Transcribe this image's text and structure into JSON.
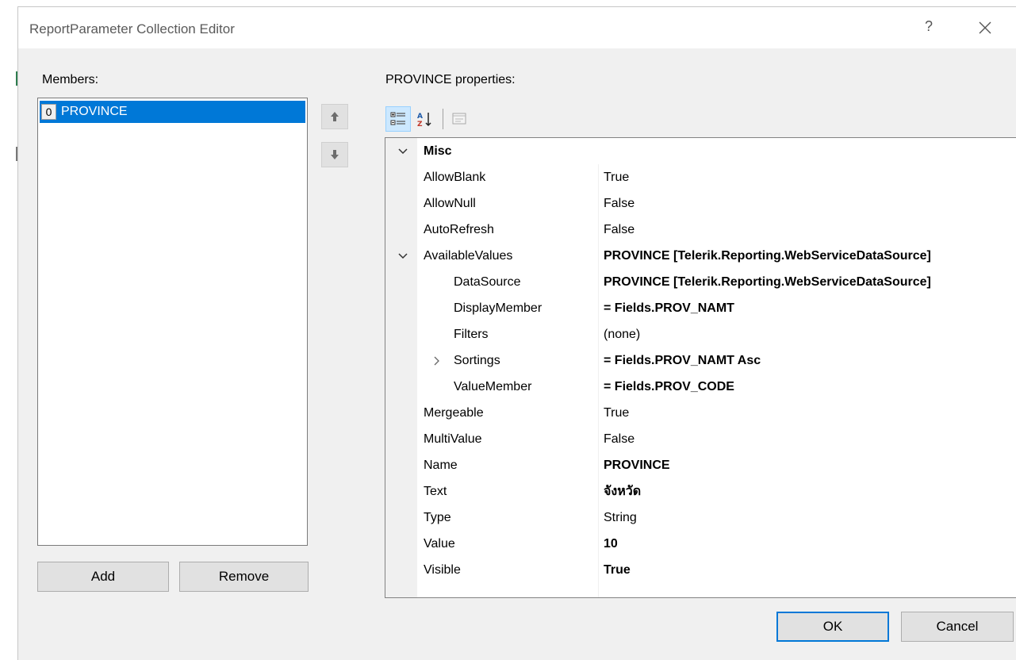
{
  "dialog": {
    "title": "ReportParameter Collection Editor",
    "help_glyph": "?",
    "accent_color": "#0078d7"
  },
  "members": {
    "label": "Members:",
    "items": [
      {
        "index": "0",
        "name": "PROVINCE",
        "selected": true
      }
    ],
    "add_label": "Add",
    "remove_label": "Remove"
  },
  "properties": {
    "label": "PROVINCE properties:",
    "toolbar": [
      "categorized-icon",
      "alphabetical-icon",
      "property-pages-icon"
    ],
    "category": "Misc",
    "rows": [
      {
        "name": "AllowBlank",
        "value": "True",
        "bold": false
      },
      {
        "name": "AllowNull",
        "value": "False",
        "bold": false
      },
      {
        "name": "AutoRefresh",
        "value": "False",
        "bold": false
      },
      {
        "name": "AvailableValues",
        "value": "PROVINCE [Telerik.Reporting.WebServiceDataSource]",
        "bold": true
      },
      {
        "name": "DataSource",
        "value": "PROVINCE [Telerik.Reporting.WebServiceDataSource]",
        "bold": true
      },
      {
        "name": "DisplayMember",
        "value": "= Fields.PROV_NAMT",
        "bold": true
      },
      {
        "name": "Filters",
        "value": "(none)",
        "bold": false
      },
      {
        "name": "Sortings",
        "value": "= Fields.PROV_NAMT Asc",
        "bold": true
      },
      {
        "name": "ValueMember",
        "value": "= Fields.PROV_CODE",
        "bold": true
      },
      {
        "name": "Mergeable",
        "value": "True",
        "bold": false
      },
      {
        "name": "MultiValue",
        "value": "False",
        "bold": false
      },
      {
        "name": "Name",
        "value": "PROVINCE",
        "bold": true
      },
      {
        "name": "Text",
        "value": "จังหวัด",
        "bold": true
      },
      {
        "name": "Type",
        "value": "String",
        "bold": false
      },
      {
        "name": "Value",
        "value": "10",
        "bold": true
      },
      {
        "name": "Visible",
        "value": "True",
        "bold": true
      }
    ]
  },
  "footer": {
    "ok_label": "OK",
    "cancel_label": "Cancel"
  }
}
